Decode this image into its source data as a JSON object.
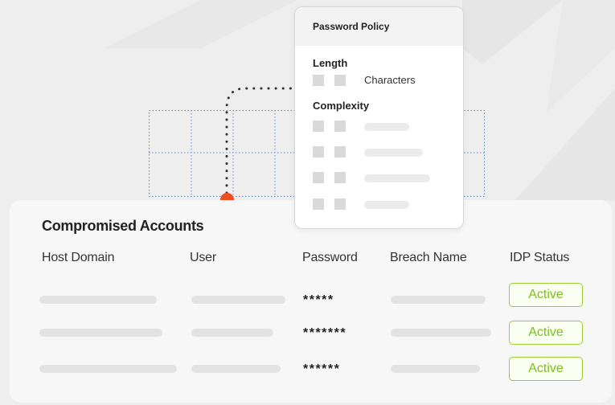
{
  "policy": {
    "title": "Password Policy",
    "length_label": "Length",
    "characters_label": "Characters",
    "complexity_label": "Complexity"
  },
  "accounts": {
    "title": "Compromised Accounts",
    "columns": [
      "Host Domain",
      "User",
      "Password",
      "Breach Name",
      "IDP Status"
    ],
    "rows": [
      {
        "password": "*****",
        "status": "Active"
      },
      {
        "password": "*******",
        "status": "Active"
      },
      {
        "password": "******",
        "status": "Active"
      }
    ]
  },
  "colors": {
    "accent_orange": "#f24b1f",
    "status_green": "#9acd32",
    "grid_blue": "#4a90e2"
  }
}
